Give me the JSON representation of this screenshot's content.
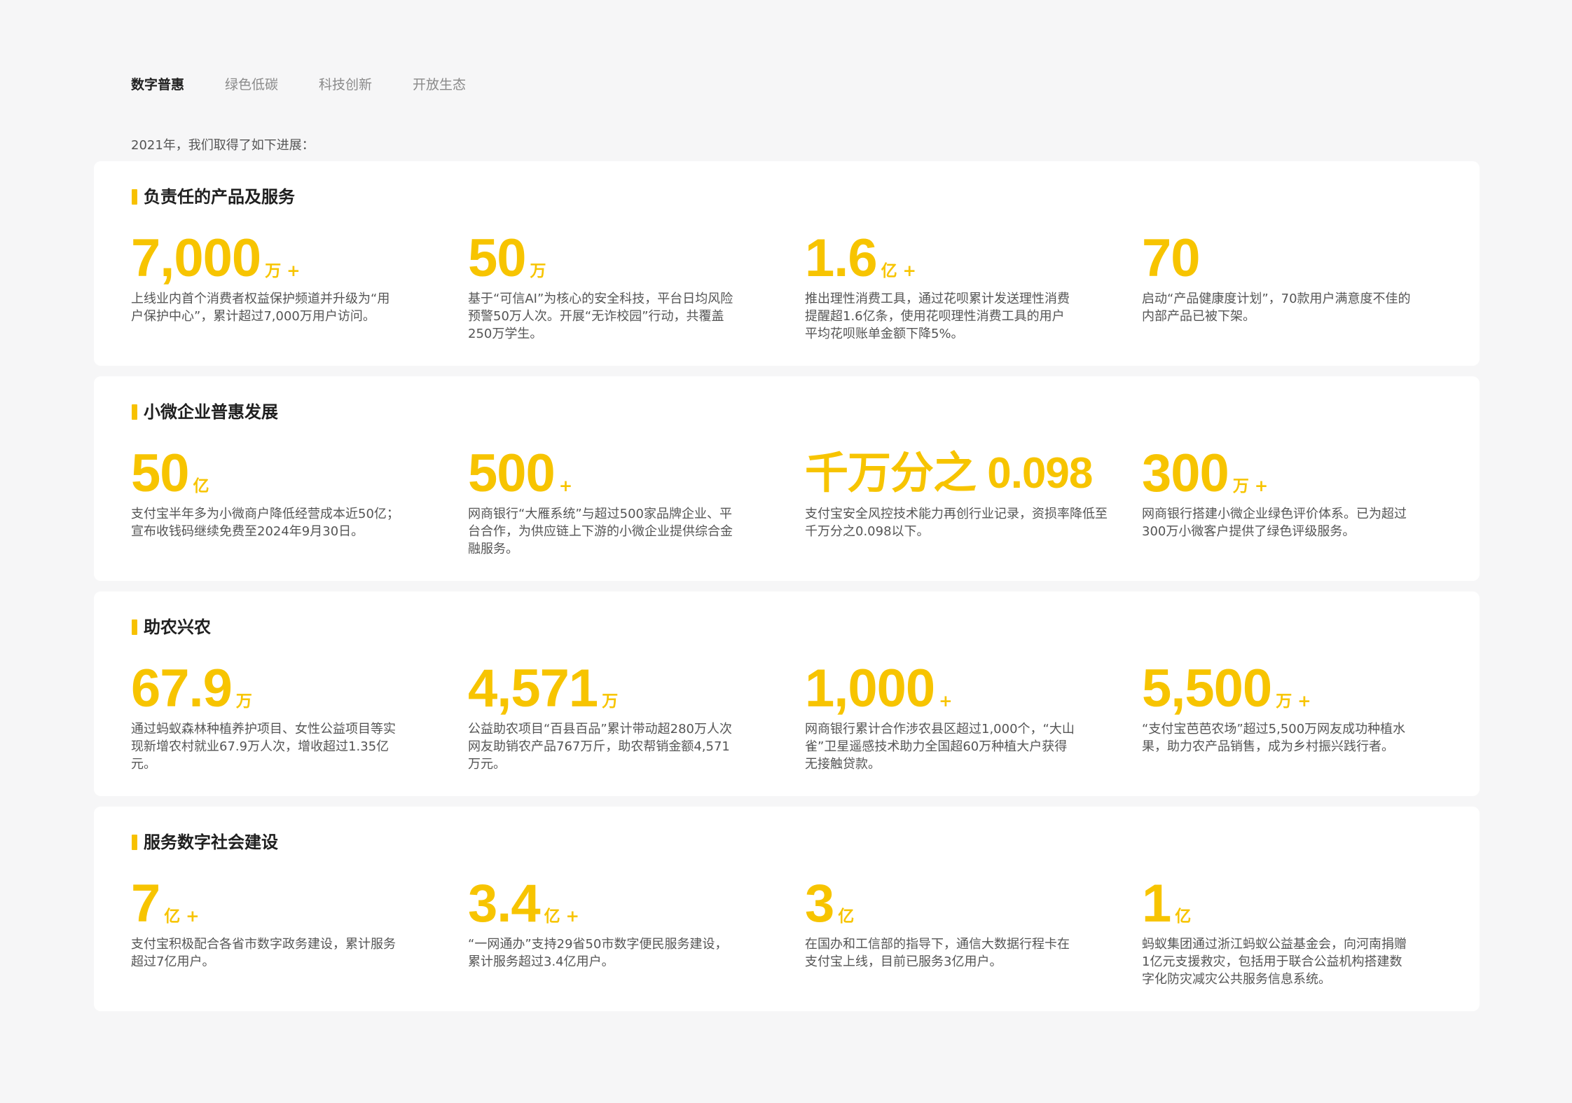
{
  "tabs": [
    "数字普惠",
    "绿色低碳",
    "科技创新",
    "开放生态"
  ],
  "intro": "2021年，我们取得了如下进展：",
  "colors": {
    "accent": "#f7c400",
    "card": "#ffffff",
    "background": "#f6f6f7"
  },
  "sections": [
    {
      "title": "负责任的产品及服务",
      "stats": [
        {
          "value": "7,000",
          "unit": "万 +",
          "desc": "上线业内首个消费者权益保护频道并升级为“用户保护中心”，累计超过7,000万用户访问。"
        },
        {
          "value": "50",
          "unit": "万",
          "desc": "基于“可信AI”为核心的安全科技，平台日均风险预警50万人次。开展“无诈校园”行动，共覆盖250万学生。"
        },
        {
          "value": "1.6",
          "unit": "亿 +",
          "desc": "推出理性消费工具，通过花呗累计发送理性消费提醒超1.6亿条，使用花呗理性消费工具的用户平均花呗账单金额下降5%。"
        },
        {
          "value": "70",
          "unit": "",
          "desc": "启动“产品健康度计划”，70款用户满意度不佳的内部产品已被下架。"
        }
      ]
    },
    {
      "title": "小微企业普惠发展",
      "stats": [
        {
          "value": "50",
          "unit": "亿",
          "desc": "支付宝半年多为小微商户降低经营成本近50亿；宣布收钱码继续免费至2024年9月30日。"
        },
        {
          "value": "500",
          "unit": "+",
          "desc": "网商银行“大雁系统”与超过500家品牌企业、平台合作，为供应链上下游的小微企业提供综合金融服务。"
        },
        {
          "value": "千万分之 0.098",
          "unit": "",
          "desc": "支付宝安全风控技术能力再创行业记录，资损率降低至千万分之0.098以下。"
        },
        {
          "value": "300",
          "unit": "万 +",
          "desc": "网商银行搭建小微企业绿色评价体系。已为超过300万小微客户提供了绿色评级服务。"
        }
      ]
    },
    {
      "title": "助农兴农",
      "stats": [
        {
          "value": "67.9",
          "unit": "万",
          "desc": "通过蚂蚁森林种植养护项目、女性公益项目等实现新增农村就业67.9万人次，增收超过1.35亿元。"
        },
        {
          "value": "4,571",
          "unit": "万",
          "desc": "公益助农项目“百县百品”累计带动超280万人次网友助销农产品767万斤，助农帮销金额4,571万元。"
        },
        {
          "value": "1,000",
          "unit": "+",
          "desc": "网商银行累计合作涉农县区超过1,000个，“大山雀”卫星遥感技术助力全国超60万种植大户获得无接触贷款。"
        },
        {
          "value": "5,500",
          "unit": "万 +",
          "desc": "“支付宝芭芭农场”超过5,500万网友成功种植水果，助力农产品销售，成为乡村振兴践行者。"
        }
      ]
    },
    {
      "title": "服务数字社会建设",
      "stats": [
        {
          "value": "7",
          "unit": "亿 +",
          "desc": "支付宝积极配合各省市数字政务建设，累计服务超过7亿用户。"
        },
        {
          "value": "3.4",
          "unit": "亿 +",
          "desc": "“一网通办”支持29省50市数字便民服务建设，累计服务超过3.4亿用户。"
        },
        {
          "value": "3",
          "unit": "亿",
          "desc": "在国办和工信部的指导下，通信大数据行程卡在支付宝上线，目前已服务3亿用户。"
        },
        {
          "value": "1",
          "unit": "亿",
          "desc": "蚂蚁集团通过浙江蚂蚁公益基金会，向河南捐赠1亿元支援救灾，包括用于联合公益机构搭建数字化防灾减灾公共服务信息系统。"
        }
      ]
    }
  ]
}
